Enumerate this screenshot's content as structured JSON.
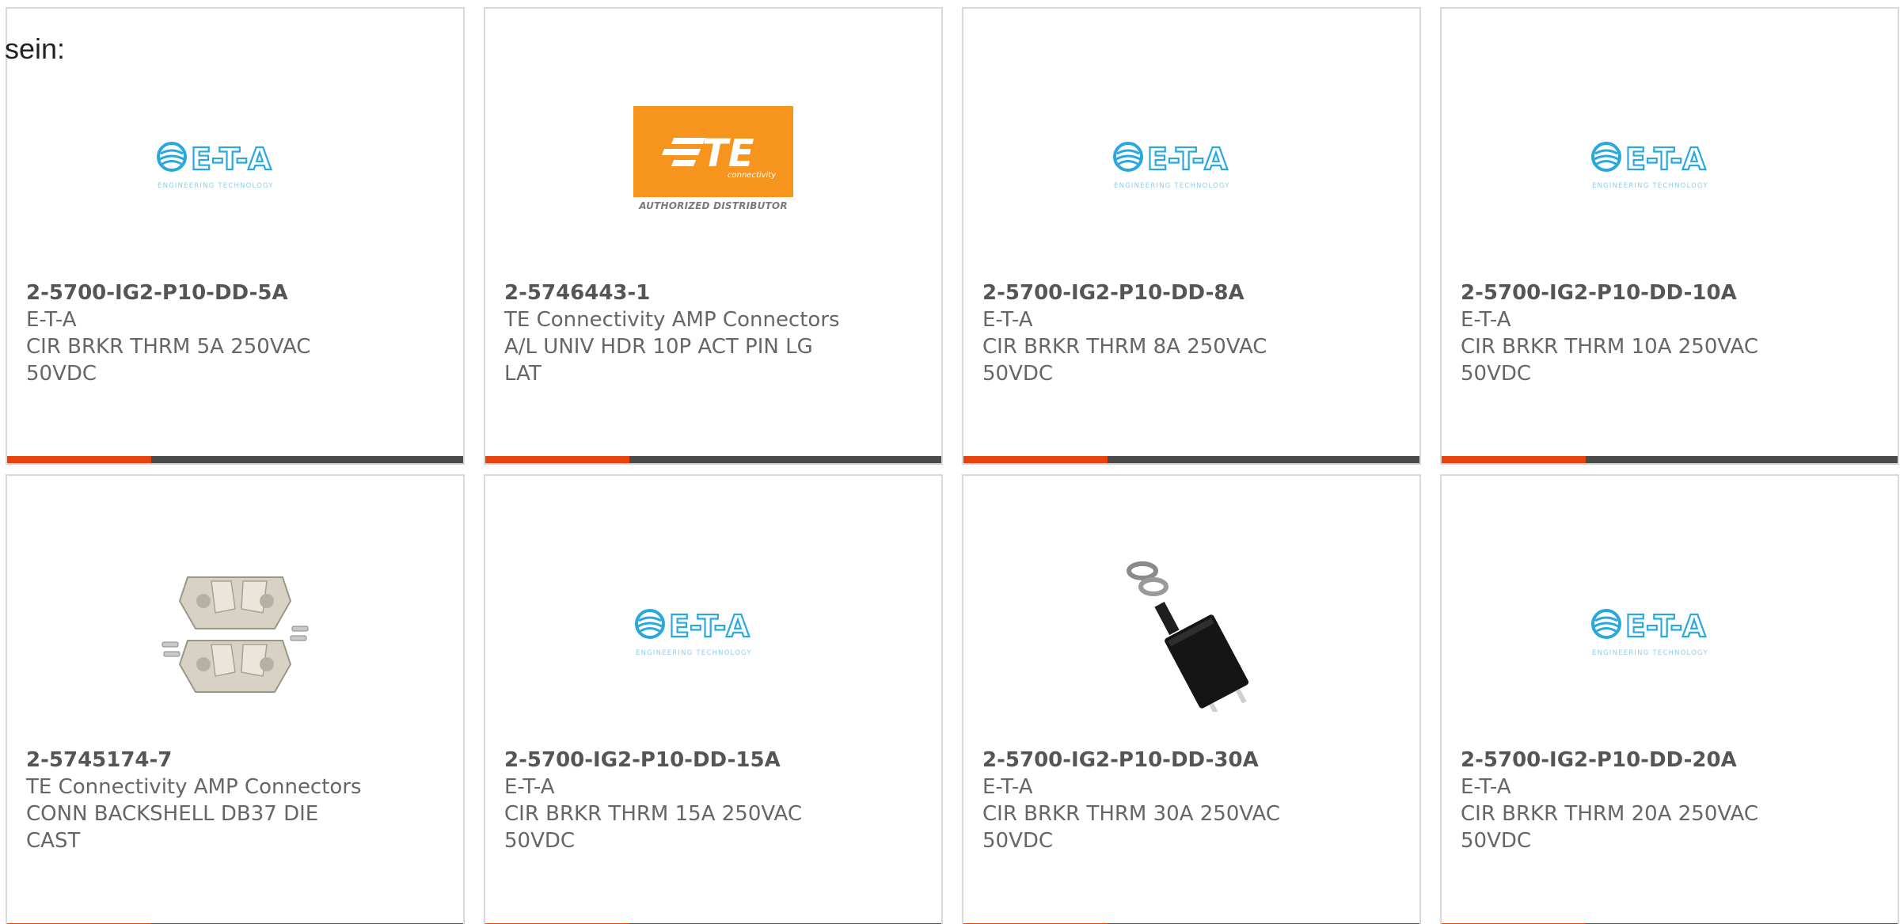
{
  "intro_text": "sein:",
  "colors": {
    "card_border": "#d9d9d9",
    "bar_dark": "#4a4a4a",
    "bar_accent": "#e8430c",
    "te_orange": "#f7941d",
    "eta_blue": "#29a8e0"
  },
  "logos": {
    "eta_name": "E-T-A",
    "eta_tagline": "ENGINEERING TECHNOLOGY",
    "te_mark": "TE",
    "te_sub": "connectivity",
    "te_distributor": "AUTHORIZED DISTRIBUTOR"
  },
  "products": [
    {
      "part_number": "2-5700-IG2-P10-DD-5A",
      "manufacturer": "E-T-A",
      "desc1": "CIR BRKR THRM 5A 250VAC",
      "desc2": "50VDC",
      "image": "eta-logo"
    },
    {
      "part_number": "2-5746443-1",
      "manufacturer": "TE Connectivity AMP Connectors",
      "desc1": "A/L UNIV HDR 10P ACT PIN LG",
      "desc2": "LAT",
      "image": "te-logo"
    },
    {
      "part_number": "2-5700-IG2-P10-DD-8A",
      "manufacturer": "E-T-A",
      "desc1": "CIR BRKR THRM 8A 250VAC",
      "desc2": "50VDC",
      "image": "eta-logo"
    },
    {
      "part_number": "2-5700-IG2-P10-DD-10A",
      "manufacturer": "E-T-A",
      "desc1": "CIR BRKR THRM 10A 250VAC",
      "desc2": "50VDC",
      "image": "eta-logo"
    },
    {
      "part_number": "2-5745174-7",
      "manufacturer": "TE Connectivity AMP Connectors",
      "desc1": "CONN BACKSHELL DB37 DIE",
      "desc2": "CAST",
      "image": "backshell-photo"
    },
    {
      "part_number": "2-5700-IG2-P10-DD-15A",
      "manufacturer": "E-T-A",
      "desc1": "CIR BRKR THRM 15A 250VAC",
      "desc2": "50VDC",
      "image": "eta-logo"
    },
    {
      "part_number": "2-5700-IG2-P10-DD-30A",
      "manufacturer": "E-T-A",
      "desc1": "CIR BRKR THRM 30A 250VAC",
      "desc2": "50VDC",
      "image": "breaker-photo"
    },
    {
      "part_number": "2-5700-IG2-P10-DD-20A",
      "manufacturer": "E-T-A",
      "desc1": "CIR BRKR THRM 20A 250VAC",
      "desc2": "50VDC",
      "image": "eta-logo"
    }
  ]
}
